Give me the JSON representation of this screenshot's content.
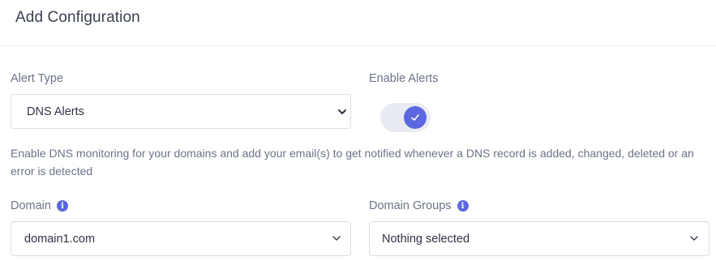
{
  "header": {
    "title": "Add Configuration"
  },
  "alert_type": {
    "label": "Alert Type",
    "value": "DNS Alerts"
  },
  "enable_alerts": {
    "label": "Enable Alerts",
    "enabled": true
  },
  "description": "Enable DNS monitoring for your domains and add your email(s) to get notified whenever a DNS record is added, changed, deleted or an error is detected",
  "domain": {
    "label": "Domain",
    "value": "domain1.com",
    "info_icon": "info-icon"
  },
  "domain_groups": {
    "label": "Domain Groups",
    "value": "Nothing selected",
    "info_icon": "info-icon"
  },
  "colors": {
    "accent": "#5b68df",
    "text": "#2f3444",
    "muted": "#6b7387",
    "border": "#dcdee6"
  }
}
